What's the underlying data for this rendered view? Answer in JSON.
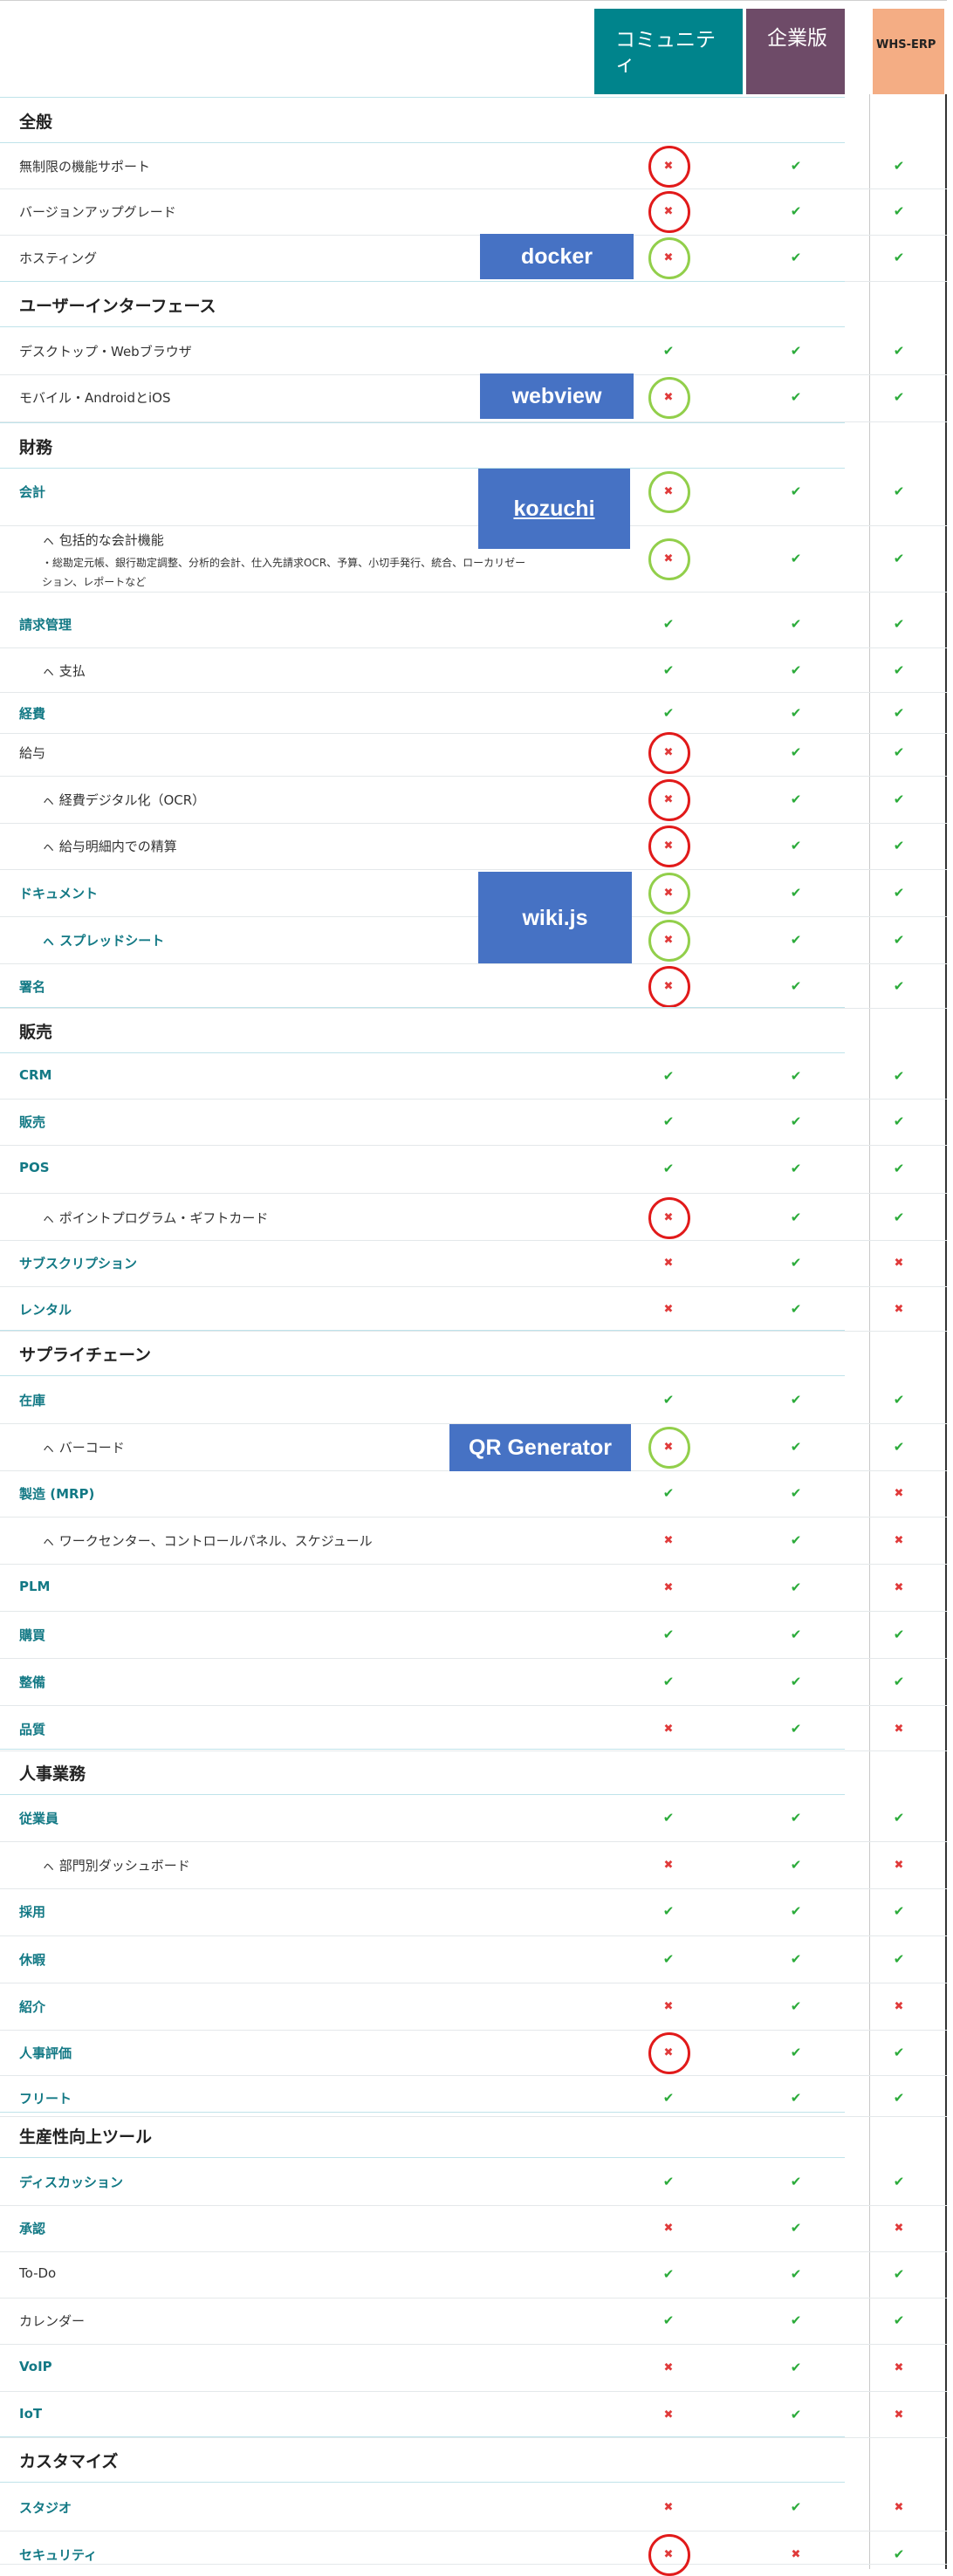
{
  "header": {
    "community": "コミュニティ",
    "enterprise": "企業版",
    "whs": "WHS-ERP"
  },
  "colors": {
    "check": "#2bab3a",
    "cross": "#e03a3a",
    "ring_red": "#e11a1a",
    "ring_green": "#92cf4b",
    "tag_blue": "#4672c4"
  },
  "rows": [
    {
      "kind": "section",
      "label": "全般"
    },
    {
      "kind": "item",
      "label": "無制限の機能サポート",
      "c": "x",
      "e": "v",
      "w": "v",
      "ring": "red"
    },
    {
      "kind": "item",
      "label": "バージョンアップグレード",
      "c": "x",
      "e": "v",
      "w": "v",
      "ring": "red"
    },
    {
      "kind": "item",
      "label": "ホスティング",
      "c": "x",
      "e": "v",
      "w": "v",
      "ring": "green",
      "tag": "docker"
    },
    {
      "kind": "section",
      "label": "ユーザーインターフェース"
    },
    {
      "kind": "item",
      "label": "デスクトップ・Webブラウザ",
      "c": "v",
      "e": "v",
      "w": "v"
    },
    {
      "kind": "item",
      "label": "モバイル・AndroidとiOS",
      "c": "x",
      "e": "v",
      "w": "v",
      "ring": "green",
      "tag": "webview"
    },
    {
      "kind": "section",
      "label": "財務"
    },
    {
      "kind": "item",
      "label": "会計",
      "link": true,
      "c": "x",
      "e": "v",
      "w": "v",
      "ring": "green",
      "tag": "kozuchi",
      "underline": true
    },
    {
      "kind": "item",
      "label": "ㇸ 包括的な会計機能",
      "sub": true,
      "c": "x",
      "e": "v",
      "w": "v",
      "ring": "green",
      "note": [
        "・総勘定元帳、銀行勘定調整、分析的会計、仕入先請求OCR、予算、小切手発行、統合、ローカリゼー",
        "ション、レポートなど"
      ]
    },
    {
      "kind": "item",
      "label": "請求管理",
      "link": true,
      "c": "v",
      "e": "v",
      "w": "v"
    },
    {
      "kind": "item",
      "label": "ㇸ 支払",
      "sub": true,
      "c": "v",
      "e": "v",
      "w": "v"
    },
    {
      "kind": "item",
      "label": "経費",
      "link": true,
      "c": "v",
      "e": "v",
      "w": "v"
    },
    {
      "kind": "item",
      "label": "給与",
      "c": "x",
      "e": "v",
      "w": "v",
      "ring": "red"
    },
    {
      "kind": "item",
      "label": "ㇸ 経費デジタル化（OCR）",
      "sub": true,
      "c": "x",
      "e": "v",
      "w": "v",
      "ring": "red"
    },
    {
      "kind": "item",
      "label": "ㇸ 給与明細内での精算",
      "sub": true,
      "c": "x",
      "e": "v",
      "w": "v",
      "ring": "red"
    },
    {
      "kind": "item",
      "label": "ドキュメント",
      "link": true,
      "c": "x",
      "e": "v",
      "w": "v",
      "ring": "green",
      "tag": "wiki.js"
    },
    {
      "kind": "item",
      "label": "ㇸ スプレッドシート",
      "link": true,
      "sub": true,
      "c": "x",
      "e": "v",
      "w": "v",
      "ring": "green"
    },
    {
      "kind": "item",
      "label": "署名",
      "link": true,
      "c": "x",
      "e": "v",
      "w": "v",
      "ring": "red"
    },
    {
      "kind": "section",
      "label": "販売"
    },
    {
      "kind": "item",
      "label": "CRM",
      "link": true,
      "c": "v",
      "e": "v",
      "w": "v"
    },
    {
      "kind": "item",
      "label": "販売",
      "link": true,
      "c": "v",
      "e": "v",
      "w": "v"
    },
    {
      "kind": "item",
      "label": "POS",
      "link": true,
      "c": "v",
      "e": "v",
      "w": "v"
    },
    {
      "kind": "item",
      "label": "ㇸ ポイントプログラム・ギフトカード",
      "sub": true,
      "c": "x",
      "e": "v",
      "w": "v",
      "ring": "red"
    },
    {
      "kind": "item",
      "label": "サブスクリプション",
      "link": true,
      "c": "x",
      "e": "v",
      "w": "x"
    },
    {
      "kind": "item",
      "label": "レンタル",
      "link": true,
      "c": "x",
      "e": "v",
      "w": "x"
    },
    {
      "kind": "section",
      "label": "サプライチェーン"
    },
    {
      "kind": "item",
      "label": "在庫",
      "link": true,
      "c": "v",
      "e": "v",
      "w": "v"
    },
    {
      "kind": "item",
      "label": "ㇸ バーコード",
      "sub": true,
      "c": "x",
      "e": "v",
      "w": "v",
      "ring": "green",
      "tag": "QR Generator"
    },
    {
      "kind": "item",
      "label": "製造 (MRP)",
      "link": true,
      "c": "v",
      "e": "v",
      "w": "x"
    },
    {
      "kind": "item",
      "label": "ㇸ ワークセンター、コントロールパネル、スケジュール",
      "sub": true,
      "c": "x",
      "e": "v",
      "w": "x"
    },
    {
      "kind": "item",
      "label": "PLM",
      "link": true,
      "c": "x",
      "e": "v",
      "w": "x"
    },
    {
      "kind": "item",
      "label": "購買",
      "link": true,
      "c": "v",
      "e": "v",
      "w": "v"
    },
    {
      "kind": "item",
      "label": "整備",
      "link": true,
      "c": "v",
      "e": "v",
      "w": "v"
    },
    {
      "kind": "item",
      "label": "品質",
      "link": true,
      "c": "x",
      "e": "v",
      "w": "x"
    },
    {
      "kind": "section",
      "label": "人事業務"
    },
    {
      "kind": "item",
      "label": "従業員",
      "link": true,
      "c": "v",
      "e": "v",
      "w": "v"
    },
    {
      "kind": "item",
      "label": "ㇸ 部門別ダッシュボード",
      "sub": true,
      "c": "x",
      "e": "v",
      "w": "x"
    },
    {
      "kind": "item",
      "label": "採用",
      "link": true,
      "c": "v",
      "e": "v",
      "w": "v"
    },
    {
      "kind": "item",
      "label": "休暇",
      "link": true,
      "c": "v",
      "e": "v",
      "w": "v"
    },
    {
      "kind": "item",
      "label": "紹介",
      "link": true,
      "c": "x",
      "e": "v",
      "w": "x"
    },
    {
      "kind": "item",
      "label": "人事評価",
      "link": true,
      "c": "x",
      "e": "v",
      "w": "v",
      "ring": "red"
    },
    {
      "kind": "item",
      "label": "フリート",
      "link": true,
      "c": "v",
      "e": "v",
      "w": "v"
    },
    {
      "kind": "section",
      "label": "生産性向上ツール"
    },
    {
      "kind": "item",
      "label": "ディスカッション",
      "link": true,
      "c": "v",
      "e": "v",
      "w": "v"
    },
    {
      "kind": "item",
      "label": "承認",
      "link": true,
      "c": "x",
      "e": "v",
      "w": "x"
    },
    {
      "kind": "item",
      "label": "To-Do",
      "c": "v",
      "e": "v",
      "w": "v"
    },
    {
      "kind": "item",
      "label": "カレンダー",
      "c": "v",
      "e": "v",
      "w": "v"
    },
    {
      "kind": "item",
      "label": "VoIP",
      "link": true,
      "c": "x",
      "e": "v",
      "w": "x"
    },
    {
      "kind": "item",
      "label": "IoT",
      "link": true,
      "c": "x",
      "e": "v",
      "w": "x"
    },
    {
      "kind": "section",
      "label": "カスタマイズ"
    },
    {
      "kind": "item",
      "label": "スタジオ",
      "link": true,
      "c": "x",
      "e": "v",
      "w": "x"
    },
    {
      "kind": "item",
      "label": "セキュリティ",
      "link": true,
      "c": "x",
      "e": "x",
      "w": "v",
      "ring": "red"
    }
  ]
}
